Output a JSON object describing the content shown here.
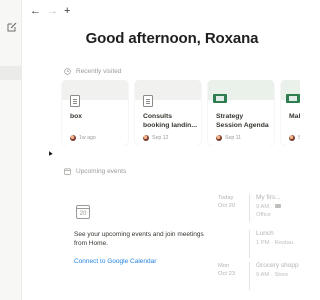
{
  "nav": {
    "back_icon": "←",
    "forward_icon": "→",
    "new_icon": "+"
  },
  "greeting": "Good afternoon, Roxana",
  "recently_visited": {
    "heading": "Recently visited",
    "cards": [
      {
        "title": "box",
        "time": "1w ago",
        "icon": "doc-icon",
        "band": "gray"
      },
      {
        "title": "Consults booking landin...",
        "time": "Sep 12",
        "icon": "doc-icon",
        "band": "gray"
      },
      {
        "title": "Strategy Session Agenda",
        "time": "Sep 11",
        "icon": "page-icon",
        "band": "green"
      },
      {
        "title": "Mak Notic",
        "time": "Se",
        "icon": "page-icon",
        "band": "green"
      }
    ]
  },
  "upcoming_events": {
    "heading": "Upcoming events",
    "calendar_day": "20",
    "empty_message": "See your upcoming events and join meetings from Home.",
    "connect_label": "Connect to Google Calendar",
    "events": [
      {
        "day": "Today",
        "date": "Oct 20",
        "title": "My firs...",
        "sub1": "9 AM",
        "sub2": "Office"
      },
      {
        "day": "",
        "date": "",
        "title": "Lunch",
        "sub1": "1 PM · Restau",
        "sub2": ""
      },
      {
        "day": "Mon",
        "date": "Oct 23",
        "title": "Grocery shopp",
        "sub1": "9 AM · Store",
        "sub2": ""
      }
    ]
  }
}
